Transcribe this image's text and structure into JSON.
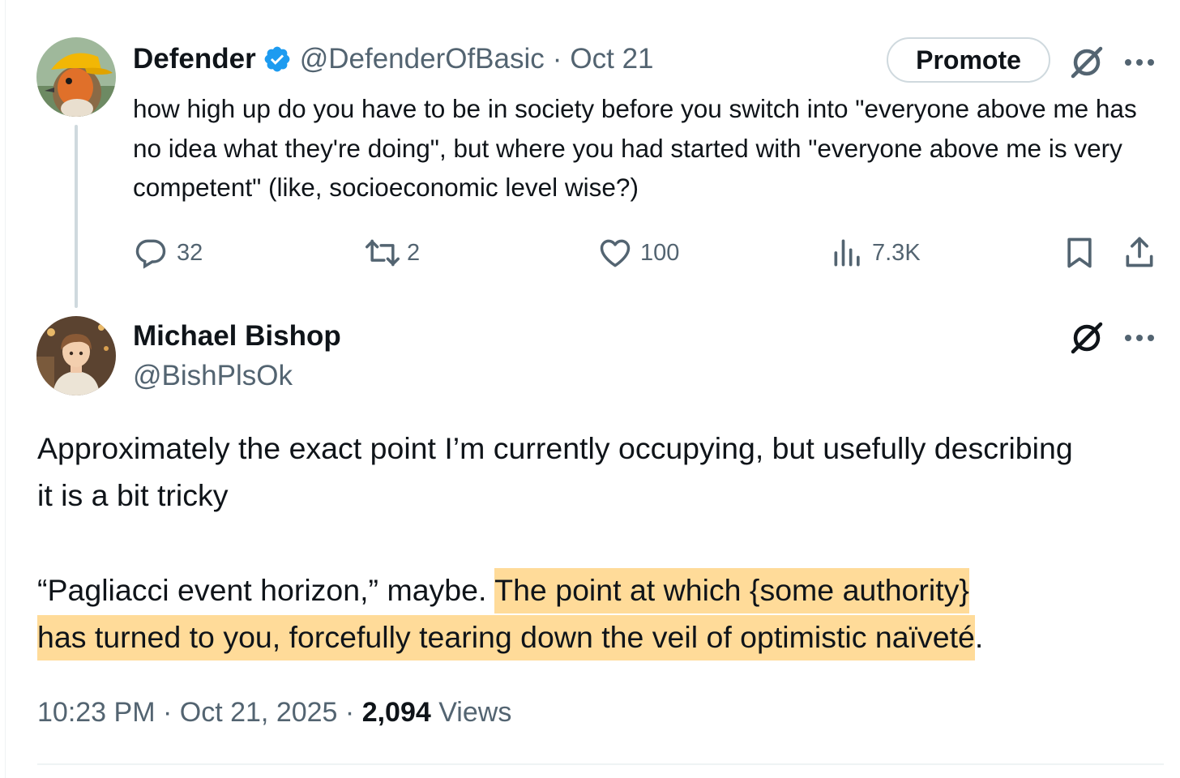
{
  "parent_tweet": {
    "author_name": "Defender",
    "handle": "@DefenderOfBasic",
    "separator": "·",
    "date": "Oct 21",
    "promote_label": "Promote",
    "text": "how high up do you have to be in society before you switch into \"everyone above me has no idea what they're doing\", but where you had started with \"everyone above me is very competent\" (like, socioeconomic level wise?)",
    "stats": {
      "replies": "32",
      "reposts": "2",
      "likes": "100",
      "views": "7.3K"
    },
    "icons": [
      "verified-badge-icon",
      "grok-icon",
      "more-icon",
      "reply-icon",
      "repost-icon",
      "like-icon",
      "views-icon",
      "bookmark-icon",
      "share-icon"
    ]
  },
  "reply_tweet": {
    "author_name": "Michael Bishop",
    "handle": "@BishPlsOk",
    "paragraph1": "Approximately the exact point I’m currently occupying, but usefully describing it is a bit tricky",
    "paragraph2_plain": "“Pagliacci event horizon,” maybe. ",
    "paragraph2_highlight_line1": "The point at which {some authority} ",
    "paragraph2_highlight_line2": "has turned to you, forcefully tearing down the veil of optimistic naïveté",
    "paragraph2_end": ".",
    "time": "10:23 PM",
    "dot": "·",
    "date": "Oct 21, 2025",
    "views_count": "2,094",
    "views_label": "Views",
    "highlight_color": "#ffdb99"
  },
  "colors": {
    "text_primary": "#0f1419",
    "text_secondary": "#536471",
    "verified_blue": "#1d9bf0",
    "thread_line": "#cfd9de"
  }
}
